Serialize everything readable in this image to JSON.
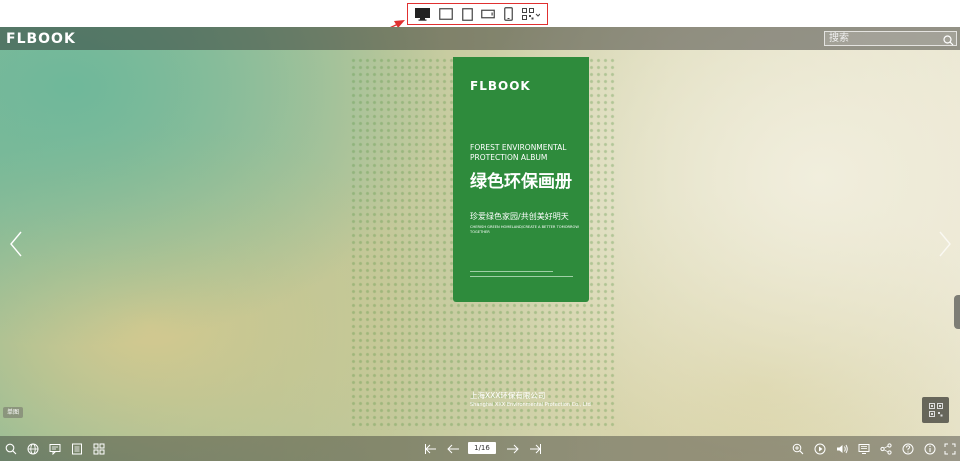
{
  "device_switcher": {
    "items": [
      {
        "name": "desktop-view-icon",
        "selected": true
      },
      {
        "name": "tablet-landscape-view-icon",
        "selected": false
      },
      {
        "name": "tablet-portrait-view-icon",
        "selected": false
      },
      {
        "name": "phone-landscape-view-icon",
        "selected": false
      },
      {
        "name": "phone-portrait-view-icon",
        "selected": false
      },
      {
        "name": "qr-code-dropdown-icon",
        "selected": false
      }
    ],
    "highlight_color": "#e03030"
  },
  "header": {
    "logo": "FLBOOK",
    "search_placeholder": "搜索"
  },
  "book": {
    "panel_logo": "FLBOOK",
    "title_en": "FOREST ENVIRONMENTAL PROTECTION ALBUM",
    "title_cn": "绿色环保画册",
    "slogan_cn": "珍爱绿色家园/共创美好明天",
    "slogan_en": "CHERISH GREEN HOMELAND/CREATE A BETTER TOMORROW TOGETHER",
    "company_cn": "上海XXX环保有限公司",
    "company_en": "Shanghai XXX Environmental Protection Co., Ltd",
    "panel_color": "#2e8b3c"
  },
  "sidebar": {
    "thumbnails_label": "单图"
  },
  "footer": {
    "page_indicator": "1/16",
    "left_tools": [
      "search-icon",
      "globe-icon",
      "comment-icon",
      "bookmark-icon",
      "thumbnails-icon"
    ],
    "nav_tools": [
      "first-page-icon",
      "previous-page-icon",
      "next-page-icon",
      "last-page-icon"
    ],
    "right_tools": [
      "zoom-in-icon",
      "autoplay-icon",
      "sound-icon",
      "notes-icon",
      "share-icon",
      "help-icon",
      "info-icon",
      "fullscreen-icon"
    ]
  }
}
